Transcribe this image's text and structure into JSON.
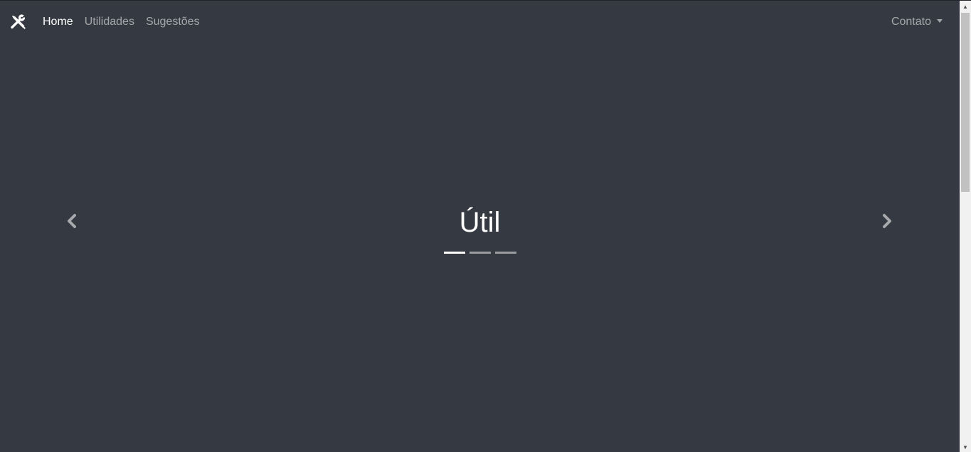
{
  "navbar": {
    "brand_icon": "tools-icon",
    "links": [
      {
        "label": "Home",
        "active": true
      },
      {
        "label": "Utilidades",
        "active": false
      },
      {
        "label": "Sugestões",
        "active": false
      }
    ],
    "dropdown_label": "Contato"
  },
  "carousel": {
    "caption": "Útil",
    "indicators": [
      {
        "active": true
      },
      {
        "active": false
      },
      {
        "active": false
      }
    ],
    "prev_icon": "chevron-left-icon",
    "next_icon": "chevron-right-icon"
  },
  "colors": {
    "background": "#353941",
    "text_active": "#ffffff",
    "text_muted": "rgba(255,255,255,0.55)"
  }
}
